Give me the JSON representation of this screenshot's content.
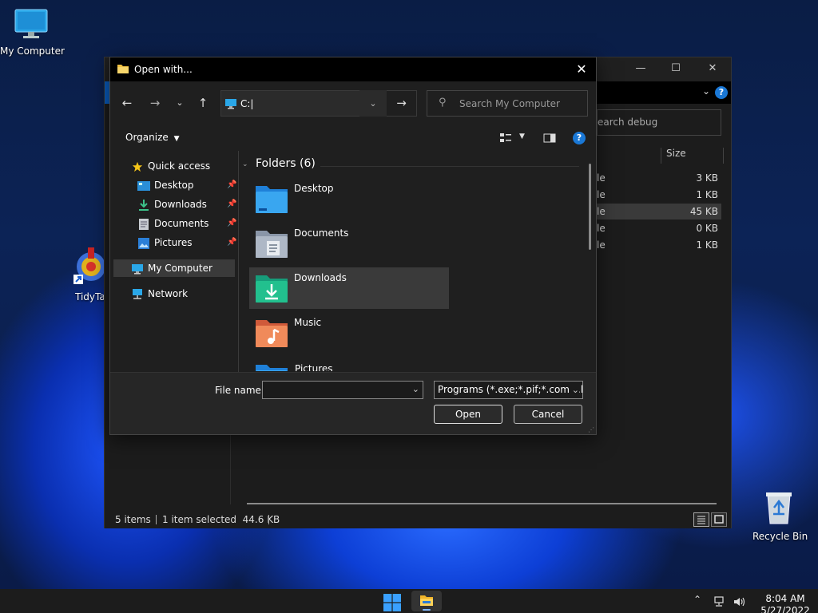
{
  "desktop": {
    "icons": [
      {
        "label": "My Computer"
      },
      {
        "label": "TidyTal"
      },
      {
        "label": "Recycle Bin"
      }
    ]
  },
  "bg_window": {
    "search_text": "earch debug",
    "column_header": "Size",
    "rows": [
      {
        "type": "le",
        "size": "3 KB"
      },
      {
        "type": "le",
        "size": "1 KB"
      },
      {
        "type": "le",
        "size": "45 KB"
      },
      {
        "type": "le",
        "size": "0 KB"
      },
      {
        "type": "le",
        "size": "1 KB"
      }
    ],
    "status": {
      "items": "5 items",
      "selected": "1 item selected  44.6 KB"
    }
  },
  "dialog": {
    "title": "Open with...",
    "address": "C:|",
    "search_placeholder": "Search My Computer",
    "organize_label": "Organize",
    "help": "?",
    "nav": {
      "quick_access": "Quick access",
      "desktop": "Desktop",
      "downloads": "Downloads",
      "documents": "Documents",
      "pictures": "Pictures",
      "my_computer": "My Computer",
      "network": "Network"
    },
    "group_header": "Folders (6)",
    "folders": [
      {
        "name": "Desktop"
      },
      {
        "name": "Documents"
      },
      {
        "name": "Downloads"
      },
      {
        "name": "Music"
      },
      {
        "name": "Pictures"
      }
    ],
    "file_name_label": "File name:",
    "file_name_value": "",
    "filter_value": "Programs (*.exe;*.pif;*.com;*.bat)",
    "open_label": "Open",
    "cancel_label": "Cancel"
  },
  "taskbar": {
    "time": "8:04 AM",
    "date": "5/27/2022"
  },
  "colors": {
    "accent": "#1a78d6",
    "dialog_bg": "#1f1f1f",
    "taskbar_bg": "#1c1c1c"
  }
}
